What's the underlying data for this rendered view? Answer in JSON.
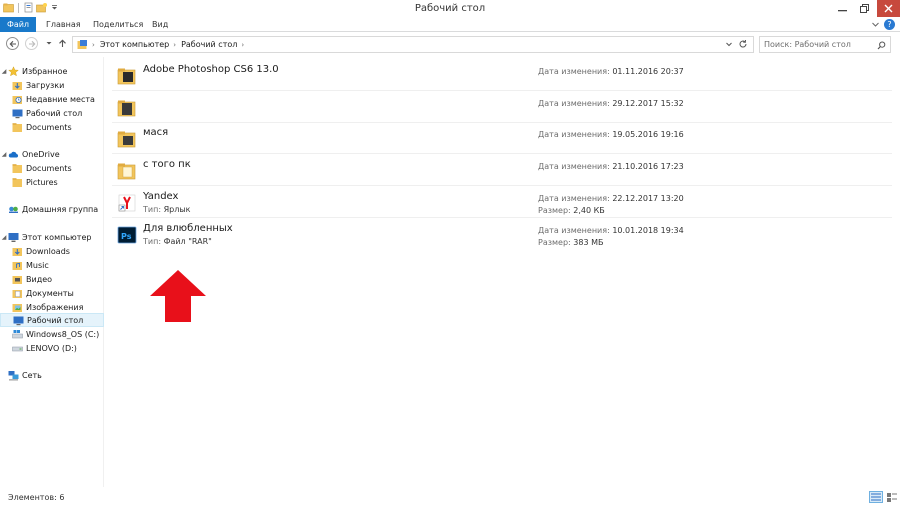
{
  "window": {
    "title": "Рабочий стол"
  },
  "ribbon": {
    "tabs": [
      "Файл",
      "Главная",
      "Поделиться",
      "Вид"
    ]
  },
  "address": {
    "crumbs": [
      "Этот компьютер",
      "Рабочий стол"
    ],
    "search_placeholder": "Поиск: Рабочий стол"
  },
  "sidebar": {
    "favorites": {
      "label": "Избранное",
      "items": [
        "Загрузки",
        "Недавние места",
        "Рабочий стол",
        "Documents"
      ]
    },
    "onedrive": {
      "label": "OneDrive",
      "items": [
        "Documents",
        "Pictures"
      ]
    },
    "homegroup": {
      "label": "Домашняя группа"
    },
    "computer": {
      "label": "Этот компьютер",
      "items": [
        "Downloads",
        "Music",
        "Видео",
        "Документы",
        "Изображения",
        "Рабочий стол",
        "Windows8_OS (C:)",
        "LENOVO (D:)"
      ]
    },
    "network": {
      "label": "Сеть"
    }
  },
  "labels": {
    "date_modified": "Дата изменения:",
    "type": "Тип:",
    "size": "Размер:"
  },
  "files": [
    {
      "name": "Adobe Photoshop CS6 13.0",
      "icon": "folder-icon",
      "date": "01.11.2016 20:37"
    },
    {
      "name": "",
      "icon": "folder-icon",
      "date": "29.12.2017 15:32"
    },
    {
      "name": "мася",
      "icon": "folder-icon",
      "date": "19.05.2016 19:16"
    },
    {
      "name": "с того пк",
      "icon": "folder-icon",
      "date": "21.10.2016 17:23"
    },
    {
      "name": "Yandex",
      "icon": "yandex-shortcut-icon",
      "date": "22.12.2017 13:20",
      "type": "Ярлык",
      "size": "2,40 КБ"
    },
    {
      "name": "Для влюбленных",
      "icon": "photoshop-icon",
      "date": "10.01.2018 19:34",
      "type": "Файл \"RAR\"",
      "size": "383 МБ"
    }
  ],
  "status": {
    "items_count": "Элементов: 6"
  },
  "colors": {
    "accent": "#1979ca",
    "close": "#c7493d",
    "arrow": "#e8101a",
    "folder": "#f2c55c"
  }
}
